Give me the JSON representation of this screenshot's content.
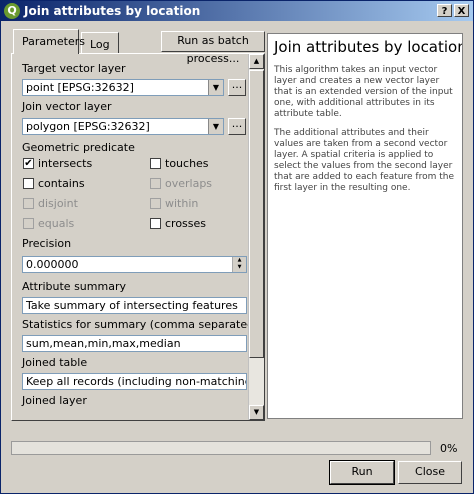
{
  "window": {
    "title": "Join attributes by location",
    "help_btn": "?",
    "close_btn": "X"
  },
  "tabs": [
    {
      "label": "Parameters",
      "active": true
    },
    {
      "label": "Log",
      "active": false
    }
  ],
  "batch_button": "Run as batch process...",
  "form": {
    "target_label": "Target vector layer",
    "target_value": "point [EPSG:32632]",
    "join_label": "Join vector layer",
    "join_value": "polygon [EPSG:32632]",
    "browse_label": "...",
    "geom_label": "Geometric predicate",
    "predicates": [
      {
        "label": "intersects",
        "checked": true,
        "enabled": true
      },
      {
        "label": "touches",
        "checked": false,
        "enabled": true
      },
      {
        "label": "contains",
        "checked": false,
        "enabled": true
      },
      {
        "label": "overlaps",
        "checked": false,
        "enabled": false
      },
      {
        "label": "disjoint",
        "checked": false,
        "enabled": false
      },
      {
        "label": "within",
        "checked": false,
        "enabled": false
      },
      {
        "label": "equals",
        "checked": false,
        "enabled": false
      },
      {
        "label": "crosses",
        "checked": false,
        "enabled": true
      }
    ],
    "precision_label": "Precision",
    "precision_value": "0.000000",
    "summary_label": "Attribute summary",
    "summary_value": "Take summary of intersecting features",
    "stats_label": "Statistics for summary (comma separated) [optional]",
    "stats_value": "sum,mean,min,max,median",
    "joined_table_label": "Joined table",
    "joined_table_value": "Keep all records (including non-matching target records)",
    "joined_layer_label": "Joined layer"
  },
  "help": {
    "title": "Join attributes by location",
    "p1": "This algorithm takes an input vector layer and creates a new vector layer that is an extended version of the input one, with additional attributes in its attribute table.",
    "p2": "The additional attributes and their values are taken from a second vector layer. A spatial criteria is applied to select the values from the second layer that are added to each feature from the first layer in the resulting one."
  },
  "progress": {
    "value": 0,
    "label": "0%"
  },
  "buttons": {
    "run": "Run",
    "close": "Close"
  },
  "icons": {
    "check": "✔",
    "combo_arrow": "▼",
    "scroll_up": "▲",
    "scroll_down": "▼"
  }
}
